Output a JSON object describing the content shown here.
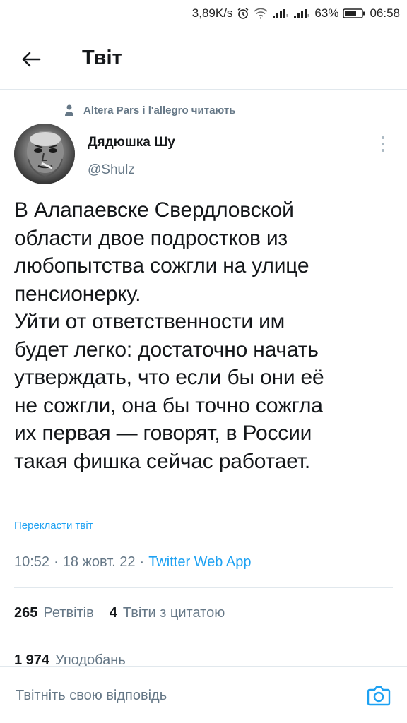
{
  "status_bar": {
    "speed": "3,89K/s",
    "battery": "63%",
    "time": "06:58"
  },
  "header": {
    "title": "Твіт"
  },
  "social_context": {
    "text": "Altera Pars і l'allegro читають"
  },
  "author": {
    "name": "Дядюшка Шу",
    "handle": "@Shulz"
  },
  "tweet": {
    "text": "В Алапаевске Свердловской\nобласти двое подростков из\nлюбопытства сожгли на улице\nпенсионерку.\nУйти от ответственности им\nбудет легко: достаточно начать\nутверждать, что если бы они её\nне сожгли, она бы точно сожгла\nих первая — говорят, в России\nтакая фишка сейчас работает.",
    "translate_label": "Перекласти твіт",
    "time": "10:52",
    "date": "18 жовт. 22",
    "source": "Twitter Web App"
  },
  "stats": {
    "retweets_count": "265",
    "retweets_label": "Ретвітів",
    "quotes_count": "4",
    "quotes_label": "Твіти з цитатою",
    "likes_count": "1 974",
    "likes_label": "Уподобань"
  },
  "reply": {
    "placeholder": "Твітніть свою відповідь"
  },
  "colors": {
    "accent": "#1da1f2",
    "secondary_text": "#657786",
    "border": "#e1e8ed"
  }
}
